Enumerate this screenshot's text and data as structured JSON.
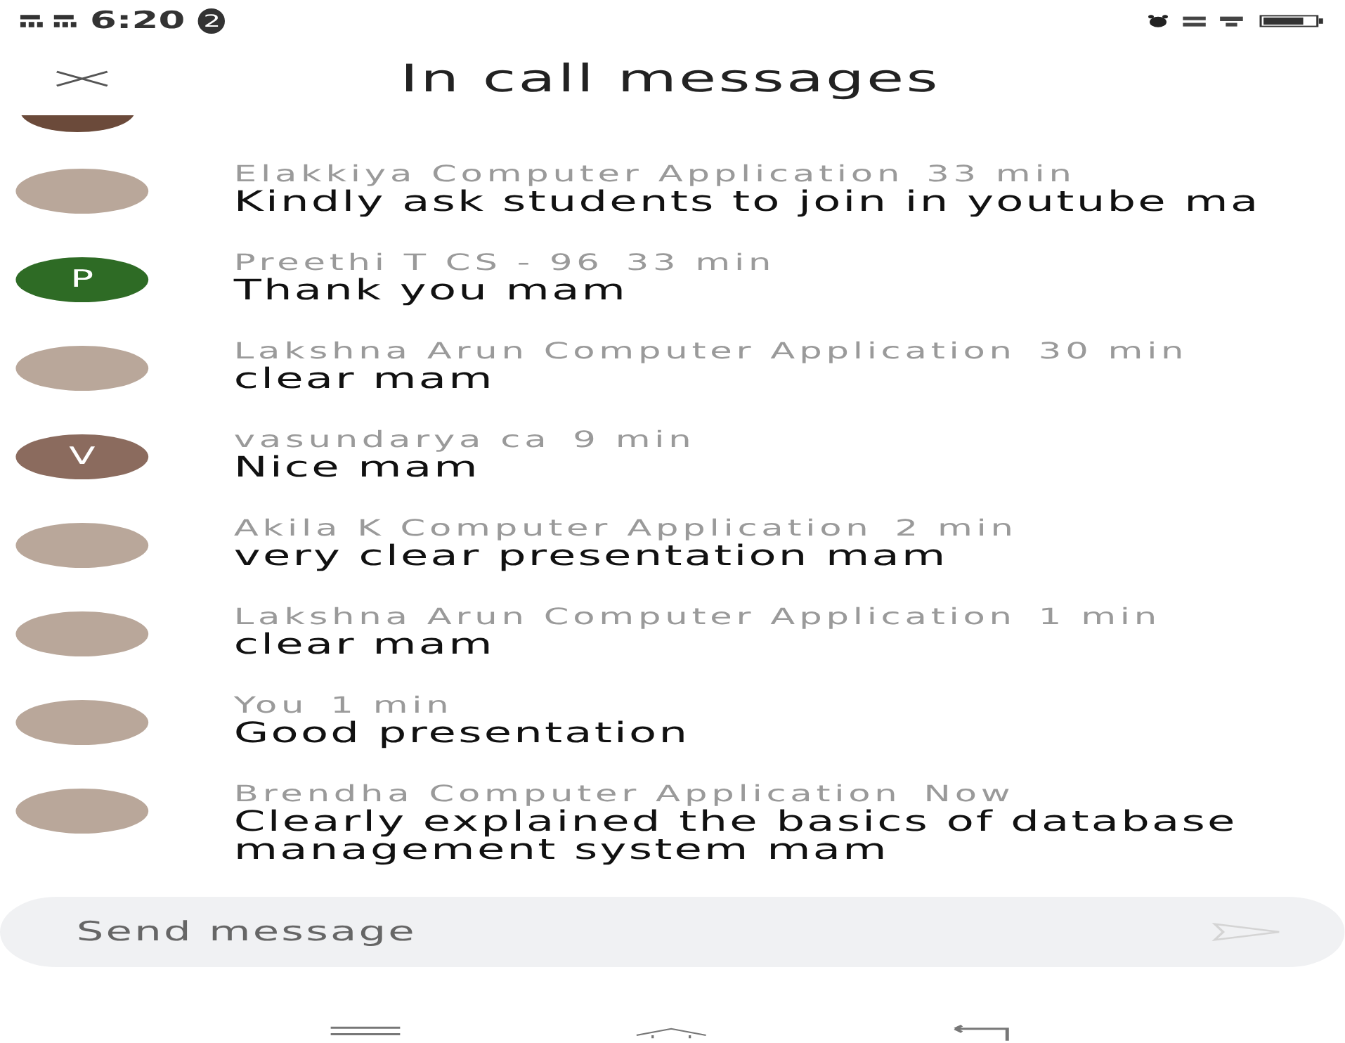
{
  "status_bar": {
    "time": "6:20",
    "notification_count": "2"
  },
  "header": {
    "title": "In call messages"
  },
  "messages": [
    {
      "sender": "Elakkiya Computer Application",
      "time": "33 min",
      "text": "Kindly ask students to join in youtube ma",
      "avatar": {
        "kind": "photo"
      }
    },
    {
      "sender": "Preethi T CS - 96",
      "time": "33 min",
      "text": "Thank you mam",
      "avatar": {
        "kind": "letter",
        "letter": "P",
        "color": "#2e6b25"
      }
    },
    {
      "sender": "Lakshna Arun Computer Application",
      "time": "30 min",
      "text": "clear mam",
      "avatar": {
        "kind": "photo"
      }
    },
    {
      "sender": "vasundarya ca",
      "time": "9 min",
      "text": "Nice mam",
      "avatar": {
        "kind": "letter",
        "letter": "V",
        "color": "#8b6b5e"
      }
    },
    {
      "sender": "Akila K Computer Application",
      "time": "2 min",
      "text": "very clear presentation mam",
      "avatar": {
        "kind": "photo"
      }
    },
    {
      "sender": "Lakshna Arun Computer Application",
      "time": "1 min",
      "text": "clear mam",
      "avatar": {
        "kind": "photo"
      }
    },
    {
      "sender": "You",
      "time": "1 min",
      "text": "Good presentation",
      "avatar": {
        "kind": "photo"
      }
    },
    {
      "sender": "Brendha Computer Application",
      "time": "Now",
      "text": "Clearly explained the basics of database management system mam",
      "avatar": {
        "kind": "photo"
      }
    }
  ],
  "composer": {
    "placeholder": "Send message"
  }
}
